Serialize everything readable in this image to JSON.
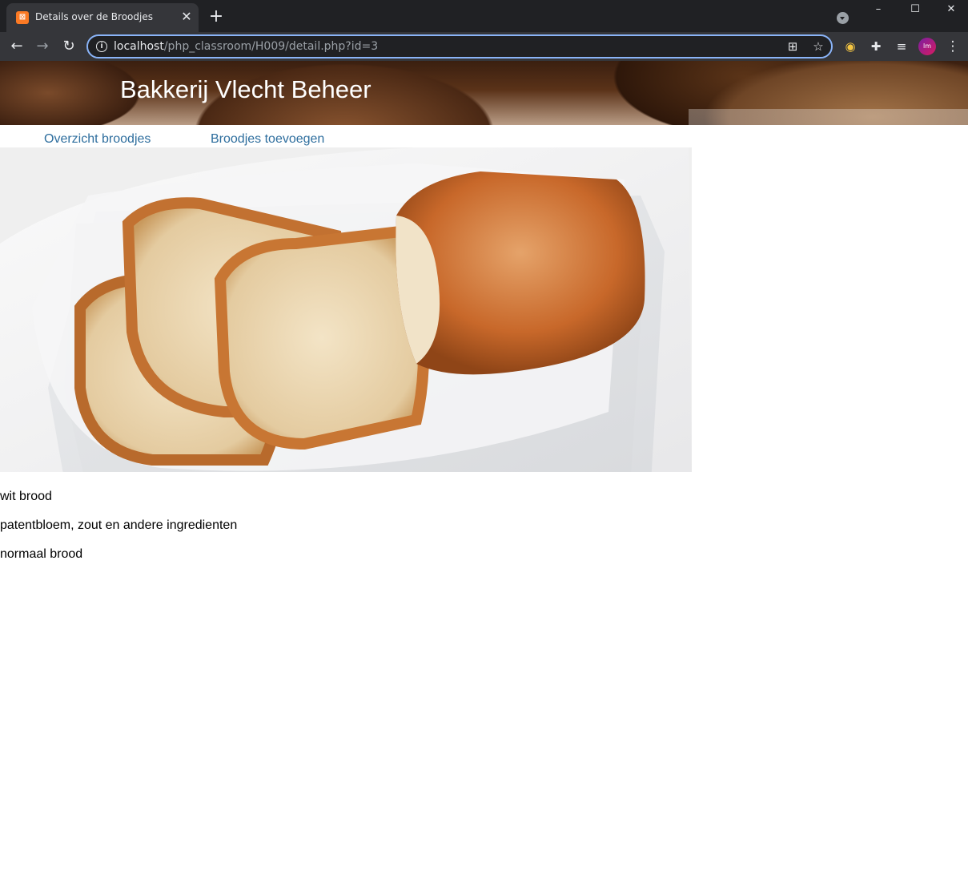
{
  "browser": {
    "tab": {
      "favicon_glyph": "ɸ",
      "title": "Details over de Broodjes",
      "close_glyph": "✕"
    },
    "new_tab_glyph": "+",
    "window_controls": {
      "minimize": "–",
      "maximize": "☐",
      "close": "✕"
    },
    "nav": {
      "back": "←",
      "forward": "→",
      "reload": "↻"
    },
    "url": {
      "host": "localhost",
      "path": "/php_classroom/H009/detail.php?id=3"
    },
    "omnibox_icons": [
      "qr-code-icon",
      "bookmark-star-icon"
    ],
    "extension_icons": [
      "owl-extension-icon",
      "puzzle-extensions-icon",
      "media-queue-icon"
    ],
    "profile_initials": "lm",
    "menu_glyph": "⋮"
  },
  "page": {
    "banner_title": "Bakkerij Vlecht Beheer",
    "nav_links": [
      {
        "label": "Overzicht broodjes"
      },
      {
        "label": "Broodjes toevoegen"
      }
    ],
    "product_image_alt": "wit brood",
    "product": {
      "name": "wit brood",
      "ingredients": "patentbloem, zout en andere ingredienten",
      "category": "normaal brood"
    }
  },
  "colors": {
    "link": "#2e6e9e",
    "chrome_dark": "#202124",
    "chrome_toolbar": "#35363a",
    "omnibox_focus": "#8ab4f8",
    "favicon": "#fb7a24"
  }
}
